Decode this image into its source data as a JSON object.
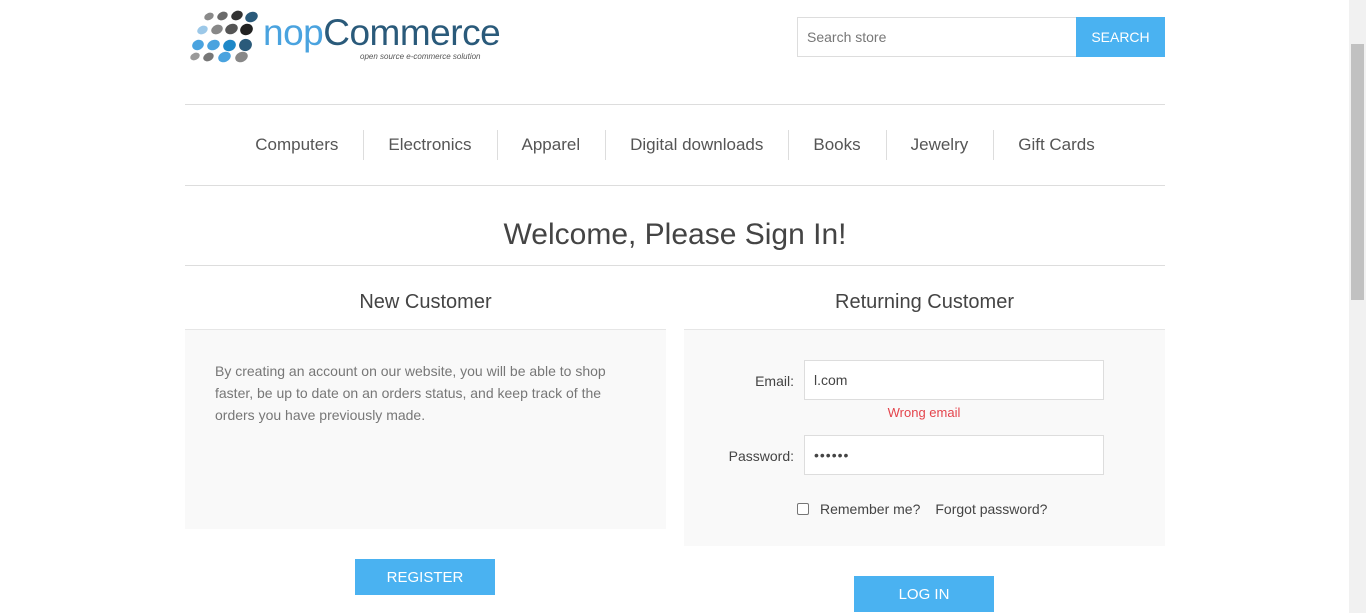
{
  "header": {
    "logo": {
      "brand_prefix": "nop",
      "brand_suffix": "Commerce",
      "tagline": "open source e-commerce solution"
    },
    "search": {
      "placeholder": "Search store",
      "button_label": "SEARCH"
    }
  },
  "menu": {
    "items": [
      "Computers",
      "Electronics",
      "Apparel",
      "Digital downloads",
      "Books",
      "Jewelry",
      "Gift Cards"
    ]
  },
  "page": {
    "title": "Welcome, Please Sign In!"
  },
  "new_customer": {
    "heading": "New Customer",
    "text": "By creating an account on our website, you will be able to shop faster, be up to date on an orders status, and keep track of the orders you have previously made.",
    "register_label": "REGISTER"
  },
  "returning_customer": {
    "heading": "Returning Customer",
    "email_label": "Email:",
    "email_value": "l.com",
    "email_error": "Wrong email",
    "password_label": "Password:",
    "password_value": "••••••",
    "remember_label": "Remember me?",
    "forgot_label": "Forgot password?",
    "login_label": "LOG IN"
  },
  "colors": {
    "accent": "#4ab2f1",
    "error": "#e4444c",
    "panel": "#f9f9f9"
  }
}
